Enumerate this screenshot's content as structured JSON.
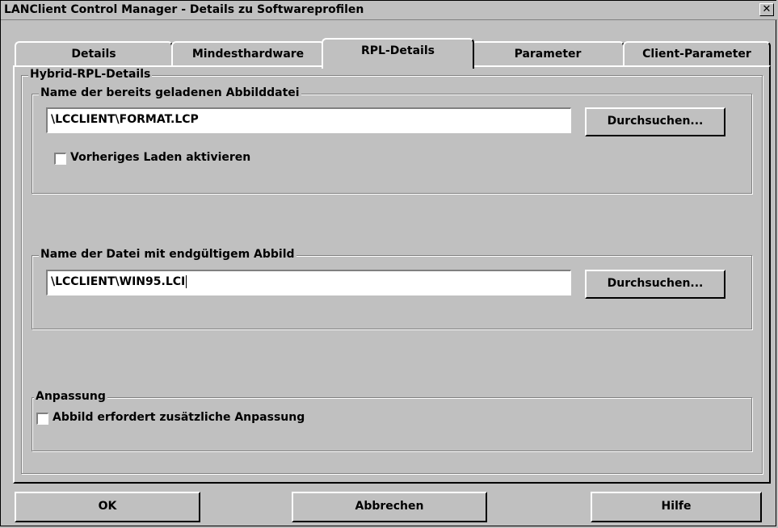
{
  "window": {
    "title": "LANClient Control Manager - Details zu Softwareprofilen",
    "close_glyph": "✕"
  },
  "tabs": [
    {
      "label": "Details"
    },
    {
      "label": "Mindesthardware"
    },
    {
      "label": "RPL-Details",
      "active": true
    },
    {
      "label": "Parameter"
    },
    {
      "label": "Client-Parameter"
    }
  ],
  "hybrid_group": {
    "legend": "Hybrid-RPL-Details"
  },
  "loaded_image": {
    "legend": "Name der bereits geladenen Abbilddatei",
    "value": "\\LCCLIENT\\FORMAT.LCP",
    "browse_label": "Durchsuchen...",
    "preload_checkbox_label": "Vorheriges Laden aktivieren",
    "preload_checked": false
  },
  "final_image": {
    "legend": "Name der Datei mit endgültigem Abbild",
    "value": "\\LCCLIENT\\WIN95.LCI",
    "browse_label": "Durchsuchen..."
  },
  "adaptation": {
    "legend": "Anpassung",
    "checkbox_label": "Abbild erfordert zusätzliche Anpassung",
    "checked": false
  },
  "footer": {
    "ok_label": "OK",
    "cancel_label": "Abbrechen",
    "help_label": "Hilfe"
  }
}
